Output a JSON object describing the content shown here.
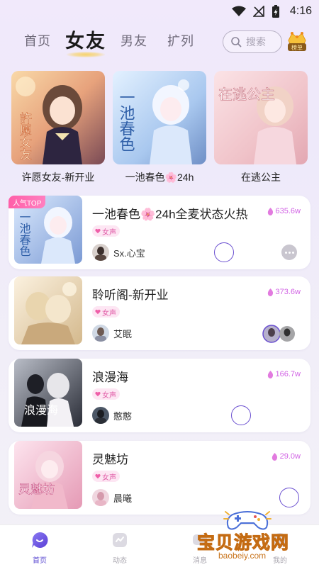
{
  "status_bar": {
    "time": "4:16"
  },
  "top_nav": {
    "tabs": [
      {
        "label": "首页"
      },
      {
        "label": "女友"
      },
      {
        "label": "男友"
      },
      {
        "label": "扩列"
      }
    ],
    "search_placeholder": "搜索",
    "rank_label": "榜单"
  },
  "featured": [
    {
      "title": "许愿女友-新开业",
      "art_text": "許愿女友"
    },
    {
      "title": "一池春色🌸24h",
      "art_text": "一池春色"
    },
    {
      "title": "在逃公主",
      "art_text": "在逃公主"
    }
  ],
  "rooms": [
    {
      "badge": "人气TOP",
      "name": "一池春色🌸24h全麦状态火热",
      "heat": "635.6w",
      "tag": "女声",
      "host": "Sx.心宝",
      "art_text": "一池春色"
    },
    {
      "name": "聆听阁-新开业",
      "heat": "373.6w",
      "tag": "女声",
      "host": "艾眠"
    },
    {
      "name": "浪漫海",
      "heat": "166.7w",
      "tag": "女声",
      "host": "憨憨",
      "art_text": "浪漫海"
    },
    {
      "name": "灵魅坊",
      "heat": "29.0w",
      "tag": "女声",
      "host": "晨曦",
      "art_text": "灵魅坊"
    }
  ],
  "bottom_nav": [
    {
      "label": "首页"
    },
    {
      "label": "动态"
    },
    {
      "label": "消息"
    },
    {
      "label": "我的"
    }
  ],
  "watermark": {
    "text": "宝贝游戏网",
    "url": "baobeiy.com"
  },
  "colors": {
    "accent": "#5b4ad1",
    "heat": "#d162e4",
    "tag": "#e05aa6"
  }
}
